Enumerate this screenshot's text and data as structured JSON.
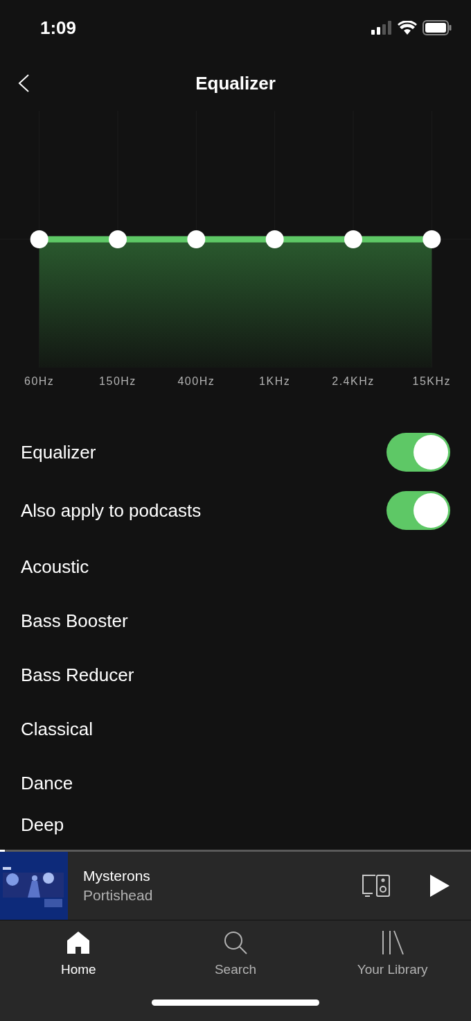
{
  "status_bar": {
    "time": "1:09"
  },
  "header": {
    "title": "Equalizer"
  },
  "bands": [
    {
      "label": "60Hz"
    },
    {
      "label": "150Hz"
    },
    {
      "label": "400Hz"
    },
    {
      "label": "1KHz"
    },
    {
      "label": "2.4KHz"
    },
    {
      "label": "15KHz"
    }
  ],
  "toggles": [
    {
      "label": "Equalizer",
      "on": true
    },
    {
      "label": "Also apply to podcasts",
      "on": true
    }
  ],
  "presets": [
    "Acoustic",
    "Bass Booster",
    "Bass Reducer",
    "Classical",
    "Dance",
    "Deep"
  ],
  "now_playing": {
    "title": "Mysterons",
    "artist": "Portishead",
    "level": 0.01
  },
  "tab_bar": [
    {
      "label": "Home",
      "kind": "home",
      "selected": true
    },
    {
      "label": "Search",
      "kind": "search",
      "selected": false
    },
    {
      "label": "Your Library",
      "kind": "library",
      "selected": false
    }
  ]
}
